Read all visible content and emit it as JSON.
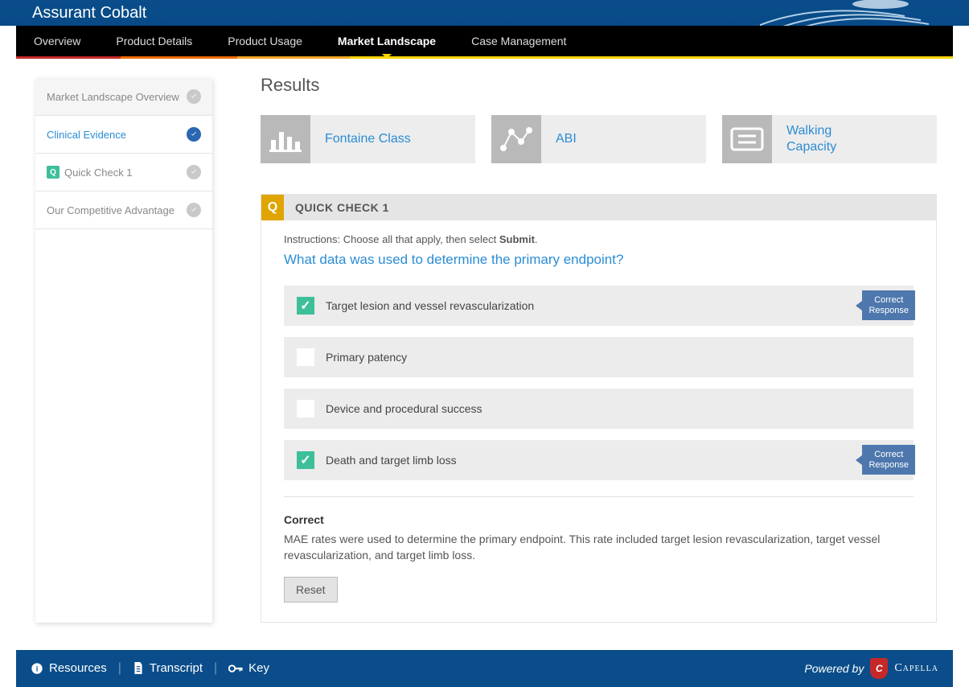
{
  "header": {
    "title": "Assurant Cobalt"
  },
  "nav": {
    "items": [
      "Overview",
      "Product Details",
      "Product Usage",
      "Market Landscape",
      "Case Management"
    ],
    "activeIndex": 3,
    "accents": [
      "#c62828",
      "#ef6c00",
      "#f9a825",
      "#fcd500",
      "#fcd500"
    ]
  },
  "sidebar": {
    "items": [
      {
        "label": "Market Landscape Overview",
        "status": "grey",
        "badge": false,
        "active": false
      },
      {
        "label": "Clinical Evidence",
        "status": "blue",
        "badge": false,
        "active": true
      },
      {
        "label": "Quick Check 1",
        "status": "grey",
        "badge": true,
        "active": false
      },
      {
        "label": "Our Competitive Advantage",
        "status": "grey",
        "badge": false,
        "active": false
      }
    ],
    "badgeLetter": "Q"
  },
  "results": {
    "title": "Results",
    "cards": [
      {
        "label": "Fontaine Class",
        "icon": "bar-chart-icon"
      },
      {
        "label": "ABI",
        "icon": "network-icon"
      },
      {
        "label": "Walking Capacity",
        "icon": "document-icon"
      }
    ]
  },
  "quiz": {
    "badge": "Q",
    "title": "QUICK CHECK 1",
    "instructions_pre": "Instructions: Choose all that apply, then select ",
    "instructions_bold": "Submit",
    "instructions_post": ".",
    "question": "What data was used to determine the primary endpoint?",
    "options": [
      {
        "label": "Target lesion and vessel revascularization",
        "checked": true,
        "flag": "Correct Response"
      },
      {
        "label": "Primary patency",
        "checked": false,
        "flag": null
      },
      {
        "label": "Device and procedural success",
        "checked": false,
        "flag": null
      },
      {
        "label": "Death and target limb loss",
        "checked": true,
        "flag": "Correct Response"
      }
    ],
    "feedback_title": "Correct",
    "feedback_text": "MAE rates were used to determine the primary endpoint. This rate included target lesion revascularization, target vessel revascularization, and target limb loss.",
    "reset_label": "Reset"
  },
  "footer": {
    "links": [
      {
        "label": "Resources",
        "icon": "info-icon"
      },
      {
        "label": "Transcript",
        "icon": "file-icon"
      },
      {
        "label": "Key",
        "icon": "key-icon"
      }
    ],
    "powered_pre": "Powered by",
    "brand": "Capella",
    "brand_badge": "C"
  }
}
